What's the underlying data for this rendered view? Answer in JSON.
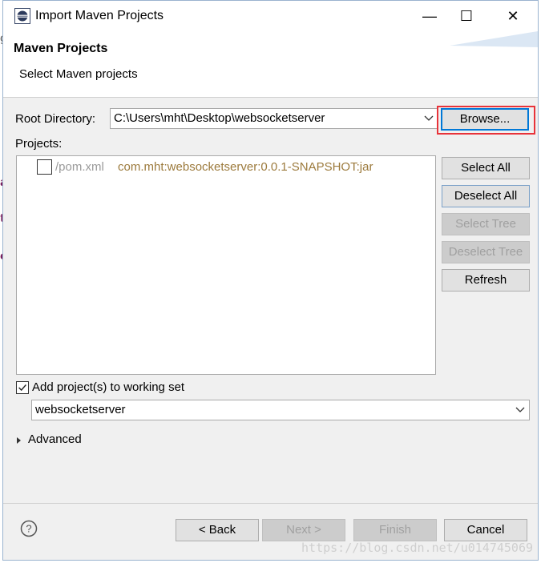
{
  "window": {
    "title": "Import Maven Projects",
    "minimize_glyph": "—",
    "maximize_glyph": "☐",
    "close_glyph": "✕"
  },
  "banner": {
    "title": "Maven Projects",
    "message": "Select Maven projects"
  },
  "root_directory": {
    "label": "Root Directory:",
    "value": "C:\\Users\\mht\\Desktop\\websocketserver",
    "browse_label": "Browse..."
  },
  "projects": {
    "label": "Projects:",
    "items": [
      {
        "path": "/pom.xml",
        "artifact": "com.mht:websocketserver:0.0.1-SNAPSHOT:jar",
        "checked": false
      }
    ]
  },
  "side_buttons": {
    "select_all": "Select All",
    "deselect_all": "Deselect All",
    "select_tree": "Select Tree",
    "deselect_tree": "Deselect Tree",
    "refresh": "Refresh"
  },
  "working_set": {
    "checkbox_label": "Add project(s) to working set",
    "checked": true,
    "value": "websocketserver"
  },
  "advanced": {
    "label": "Advanced"
  },
  "footer": {
    "back": "< Back",
    "next": "Next >",
    "finish": "Finish",
    "cancel": "Cancel"
  },
  "watermark": "https://blog.csdn.net/u014745069",
  "colors": {
    "highlight_border": "#e8333a",
    "artifact_text": "#9c7a3c",
    "disabled_text": "#a0a0a0",
    "focus_blue": "#0078d7"
  }
}
